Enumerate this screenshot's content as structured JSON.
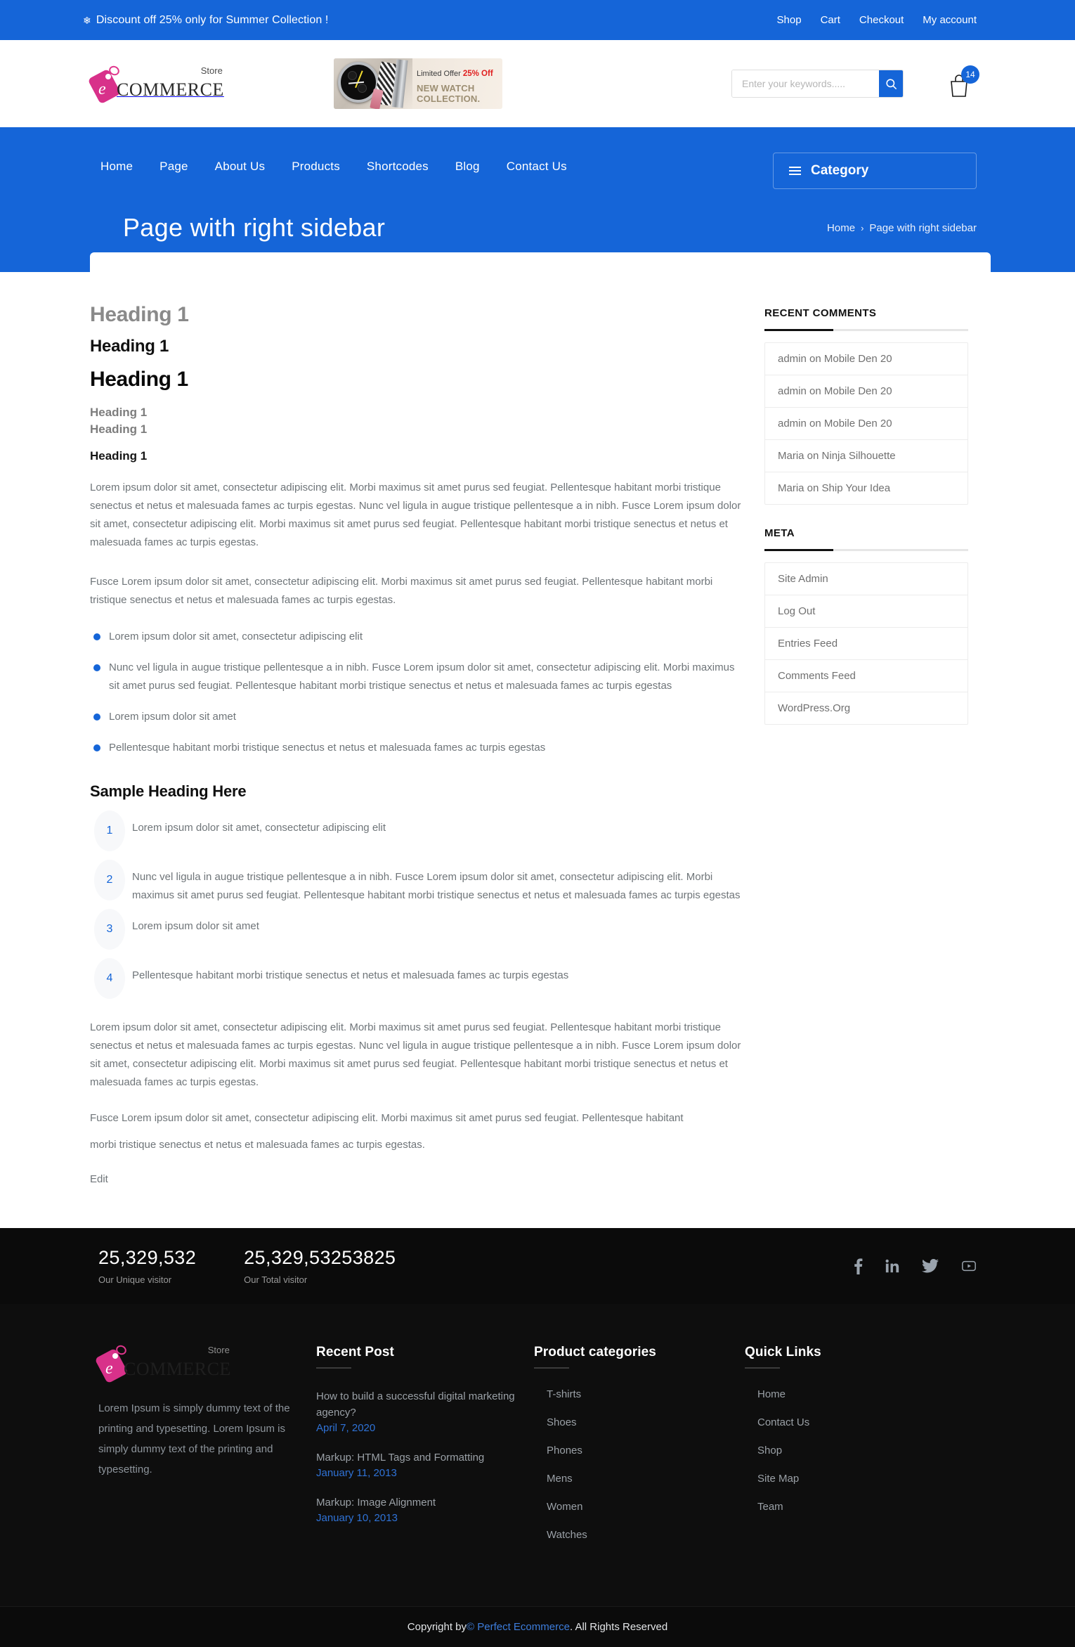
{
  "topbar": {
    "promo": "Discount off 25% only for Summer Collection !",
    "snow_icon": "snowflake-icon",
    "links": [
      "Shop",
      "Cart",
      "Checkout",
      "My account"
    ]
  },
  "header": {
    "logo": {
      "store": "Store",
      "commerce": "COMMERCE",
      "mark_letter": "e"
    },
    "banner": {
      "line1_prefix": "Limited Offer ",
      "line1_highlight": "25% Off",
      "line2": "NEW WATCH COLLECTION."
    },
    "search": {
      "placeholder": "Enter your keywords.....",
      "value": "",
      "icon": "search-icon"
    },
    "cart": {
      "count": "14",
      "icon": "shopping-bag-icon"
    }
  },
  "nav": {
    "items": [
      "Home",
      "Page",
      "About Us",
      "Products",
      "Shortcodes",
      "Blog",
      "Contact Us"
    ],
    "category_label": "Category"
  },
  "hero": {
    "title": "Page with right sidebar",
    "breadcrumb": {
      "home": "Home",
      "separator": "›",
      "current": "Page with right sidebar"
    }
  },
  "content": {
    "headings": [
      "Heading 1",
      "Heading 1",
      "Heading 1",
      "Heading 1",
      "Heading 1",
      "Heading 1"
    ],
    "paragraph_1": "Lorem ipsum dolor sit amet, consectetur adipiscing elit. Morbi maximus sit amet purus sed feugiat. Pellentesque habitant morbi tristique senectus et netus et malesuada fames ac turpis egestas. Nunc vel ligula in augue tristique pellentesque a in nibh. Fusce Lorem ipsum dolor sit amet, consectetur adipiscing elit. Morbi maximus sit amet purus sed feugiat. Pellentesque habitant morbi tristique senectus et netus et malesuada fames ac turpis egestas.",
    "paragraph_2": "Fusce Lorem ipsum dolor sit amet, consectetur adipiscing elit. Morbi maximus sit amet purus sed feugiat. Pellentesque habitant morbi tristique senectus et netus et malesuada fames ac turpis egestas.",
    "bullets": [
      "Lorem ipsum dolor sit amet, consectetur adipiscing elit",
      "Nunc vel ligula in augue tristique pellentesque a in nibh. Fusce Lorem ipsum dolor sit amet, consectetur adipiscing elit. Morbi maximus sit amet purus sed feugiat. Pellentesque habitant morbi tristique senectus et netus et malesuada fames ac turpis egestas",
      "Lorem ipsum dolor sit amet",
      "Pellentesque habitant morbi tristique senectus et netus et malesuada fames ac turpis egestas"
    ],
    "sample_heading": "Sample Heading Here",
    "numbered": [
      {
        "n": "1",
        "text": "Lorem ipsum dolor sit amet, consectetur adipiscing elit"
      },
      {
        "n": "2",
        "text": "Nunc vel ligula in augue tristique pellentesque a in nibh. Fusce Lorem ipsum dolor sit amet, consectetur adipiscing elit. Morbi maximus sit amet purus sed feugiat. Pellentesque habitant morbi tristique senectus et netus et malesuada fames ac turpis egestas"
      },
      {
        "n": "3",
        "text": "Lorem ipsum dolor sit amet"
      },
      {
        "n": "4",
        "text": "Pellentesque habitant morbi tristique senectus et netus et malesuada fames ac turpis egestas"
      }
    ],
    "paragraph_3": "Lorem ipsum dolor sit amet, consectetur adipiscing elit. Morbi maximus sit amet purus sed feugiat. Pellentesque habitant morbi tristique senectus et netus et malesuada fames ac turpis egestas. Nunc vel ligula in augue tristique pellentesque a in nibh. Fusce Lorem ipsum dolor sit amet, consectetur adipiscing elit. Morbi maximus sit amet purus sed feugiat. Pellentesque habitant morbi tristique senectus et netus et malesuada fames ac turpis egestas.",
    "paragraph_4_clipped": "Fusce Lorem ipsum dolor sit amet, consectetur adipiscing elit. Morbi maximus sit amet purus sed feugiat. Pellentesque habitant",
    "paragraph_4_tail": "morbi tristique senectus et netus et malesuada fames ac turpis egestas.",
    "edit_label": "Edit"
  },
  "sidebar": {
    "recent_comments": {
      "title": "RECENT COMMENTS",
      "items": [
        "admin on Mobile Den 20",
        "admin on Mobile Den 20",
        "admin on Mobile Den 20",
        "Maria on Ninja Silhouette",
        "Maria on Ship Your Idea"
      ]
    },
    "meta": {
      "title": "META",
      "items": [
        "Site Admin",
        "Log Out",
        "Entries Feed",
        "Comments Feed",
        "WordPress.Org"
      ]
    }
  },
  "visitor_bar": {
    "unique": {
      "number": "25,329,532",
      "label": "Our Unique visitor"
    },
    "total": {
      "number": "25,329,53253825",
      "label": "Our Total visitor"
    },
    "socials": [
      "facebook-icon",
      "linkedin-icon",
      "twitter-icon",
      "youtube-icon"
    ]
  },
  "footer": {
    "logo": {
      "store": "Store",
      "commerce": "COMMERCE",
      "mark_letter": "e"
    },
    "description": "Lorem Ipsum is simply dummy text of the printing and typesetting. Lorem Ipsum is simply dummy text of the printing and typesetting.",
    "recent_post": {
      "title": "Recent Post",
      "items": [
        {
          "title": "How to build a successful digital marketing agency?",
          "date": "April 7, 2020"
        },
        {
          "title": "Markup: HTML Tags and Formatting",
          "date": "January 11, 2013"
        },
        {
          "title": "Markup: Image Alignment",
          "date": "January 10, 2013"
        }
      ]
    },
    "product_categories": {
      "title": "Product categories",
      "items": [
        "T-shirts",
        "Shoes",
        "Phones",
        "Mens",
        "Women",
        "Watches"
      ]
    },
    "quick_links": {
      "title": "Quick Links",
      "items": [
        "Home",
        "Contact Us",
        "Shop",
        "Site Map",
        "Team"
      ]
    }
  },
  "copyright": {
    "prefix": "Copyright by ",
    "link": "© Perfect Ecommerce",
    "suffix": ". All Rights Reserved"
  },
  "colors": {
    "brand_blue": "#1565d8",
    "logo_pink": "#e0368c",
    "footer_dark": "#0e0e0e",
    "link_blue": "#2f72d6"
  }
}
